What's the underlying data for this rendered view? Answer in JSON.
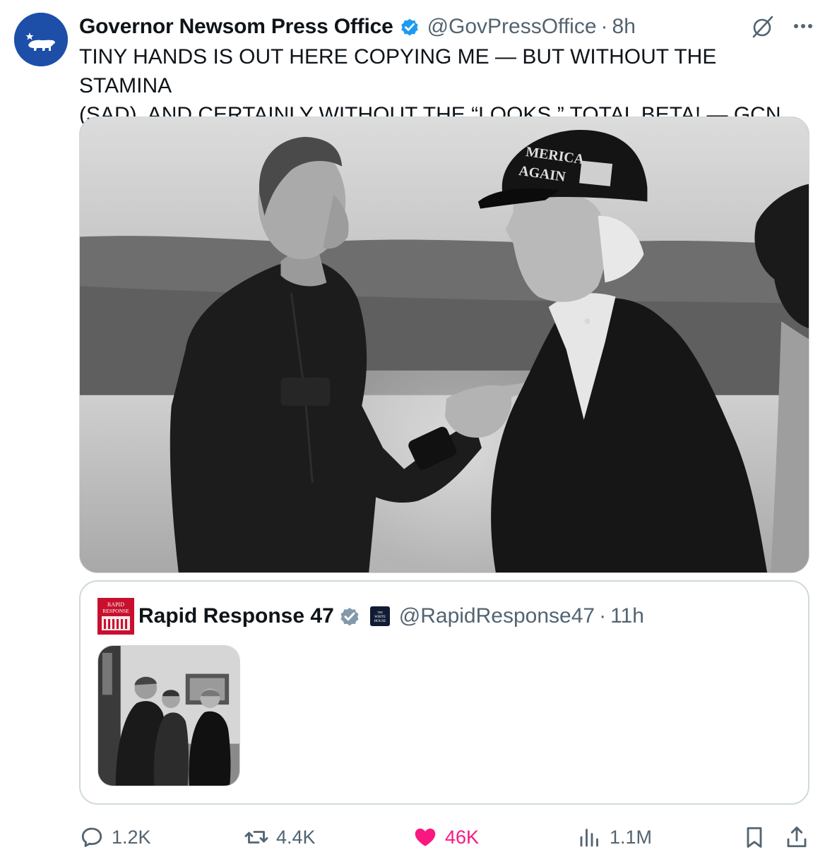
{
  "tweet": {
    "author_name": "Governor Newsom Press Office",
    "handle": "@GovPressOffice",
    "separator": "·",
    "time": "8h",
    "text": "TINY HANDS IS OUT HERE COPYING ME — BUT WITHOUT THE STAMINA\n(SAD), AND CERTAINLY WITHOUT THE “LOOKS.” TOTAL BETA! — GCN",
    "icons": {
      "avatar": "california-bear-icon",
      "verified": "verified-badge-icon",
      "grok": "grok-icon",
      "more": "more-icon"
    },
    "colors": {
      "verified": "#1d9bf0",
      "avatar_bg": "#1d4fa8",
      "like": "#f91880",
      "muted": "#536471"
    }
  },
  "media_cap_text": [
    "MERICA",
    "AGAIN"
  ],
  "quote": {
    "author_name": "Rapid Response 47",
    "handle": "@RapidResponse47",
    "separator": "·",
    "time": "11h",
    "avatar_text": [
      "RAPID",
      "RESPONSE"
    ],
    "affiliate_text": [
      "THE",
      "WHITE",
      "HOUSE"
    ],
    "icons": {
      "verified": "verified-badge-gray-icon",
      "affiliate": "white-house-badge-icon"
    },
    "colors": {
      "verified": "#829aab",
      "avatar_bg": "#c8102e"
    }
  },
  "actions": {
    "replies": "1.2K",
    "reposts": "4.4K",
    "likes": "46K",
    "views": "1.1M",
    "icons": {
      "reply": "reply-icon",
      "repost": "repost-icon",
      "like": "heart-filled-icon",
      "views": "views-icon",
      "bookmark": "bookmark-icon",
      "share": "share-icon"
    }
  }
}
